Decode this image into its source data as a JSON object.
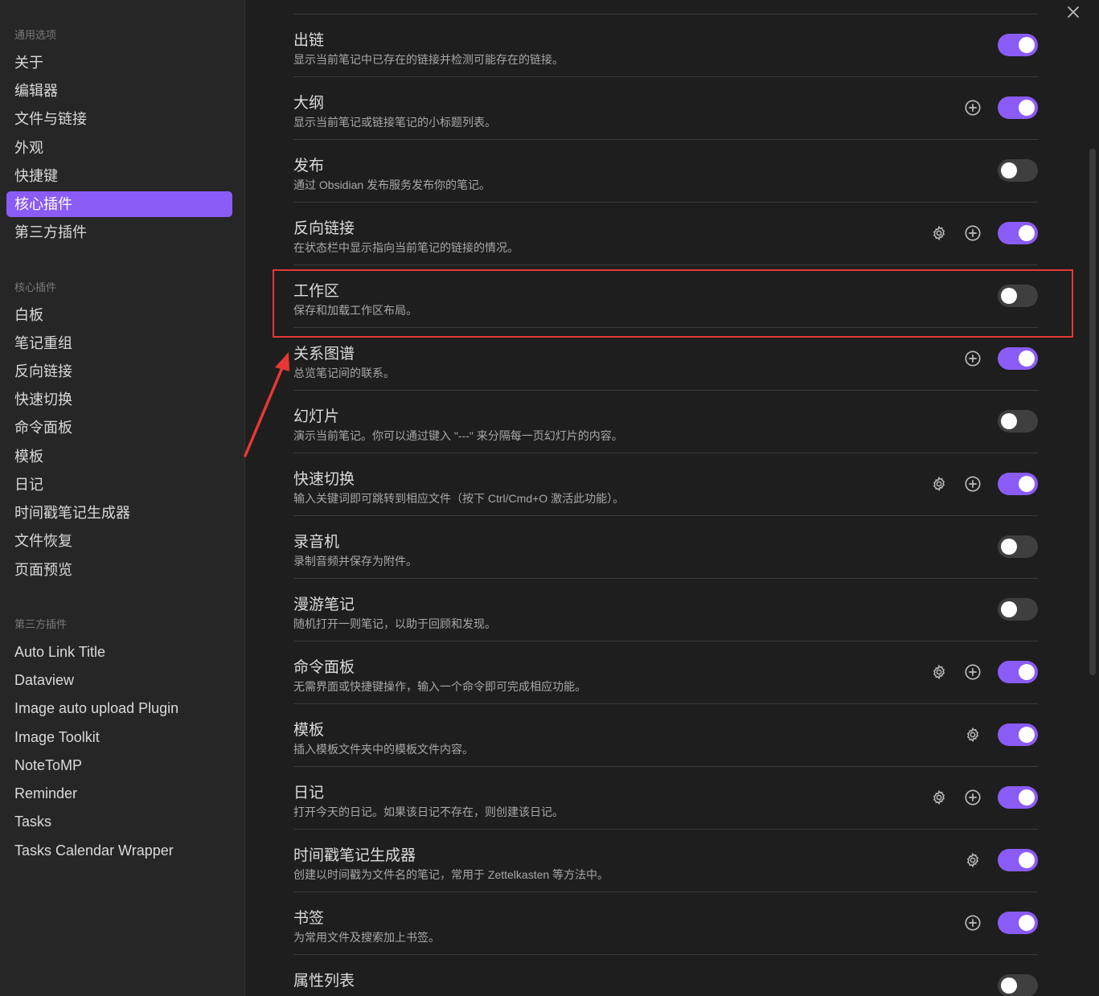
{
  "sidebar": {
    "general_title": "通用选项",
    "general": [
      "关于",
      "编辑器",
      "文件与链接",
      "外观",
      "快捷键",
      "核心插件",
      "第三方插件"
    ],
    "core_title": "核心插件",
    "core": [
      "白板",
      "笔记重组",
      "反向链接",
      "快速切换",
      "命令面板",
      "模板",
      "日记",
      "时间戳笔记生成器",
      "文件恢复",
      "页面预览"
    ],
    "community_title": "第三方插件",
    "community": [
      "Auto Link Title",
      "Dataview",
      "Image auto upload Plugin",
      "Image Toolkit",
      "NoteToMP",
      "Reminder",
      "Tasks",
      "Tasks Calendar Wrapper"
    ],
    "active_item": "核心插件"
  },
  "settings": [
    {
      "title": "出链",
      "desc": "显示当前笔记中已存在的链接并检测可能存在的链接。",
      "gear": false,
      "add": false,
      "enabled": true
    },
    {
      "title": "大纲",
      "desc": "显示当前笔记或链接笔记的小标题列表。",
      "gear": false,
      "add": true,
      "enabled": true
    },
    {
      "title": "发布",
      "desc": "通过 Obsidian 发布服务发布你的笔记。",
      "gear": false,
      "add": false,
      "enabled": false
    },
    {
      "title": "反向链接",
      "desc": "在状态栏中显示指向当前笔记的链接的情况。",
      "gear": true,
      "add": true,
      "enabled": true
    },
    {
      "title": "工作区",
      "desc": "保存和加载工作区布局。",
      "gear": false,
      "add": false,
      "enabled": false
    },
    {
      "title": "关系图谱",
      "desc": "总览笔记间的联系。",
      "gear": false,
      "add": true,
      "enabled": true
    },
    {
      "title": "幻灯片",
      "desc": "演示当前笔记。你可以通过键入 \"---\" 来分隔每一页幻灯片的内容。",
      "gear": false,
      "add": false,
      "enabled": false
    },
    {
      "title": "快速切换",
      "desc": "输入关键词即可跳转到相应文件（按下 Ctrl/Cmd+O 激活此功能）。",
      "gear": true,
      "add": true,
      "enabled": true
    },
    {
      "title": "录音机",
      "desc": "录制音频并保存为附件。",
      "gear": false,
      "add": false,
      "enabled": false
    },
    {
      "title": "漫游笔记",
      "desc": "随机打开一则笔记，以助于回顾和发现。",
      "gear": false,
      "add": false,
      "enabled": false
    },
    {
      "title": "命令面板",
      "desc": "无需界面或快捷键操作，输入一个命令即可完成相应功能。",
      "gear": true,
      "add": true,
      "enabled": true
    },
    {
      "title": "模板",
      "desc": "插入模板文件夹中的模板文件内容。",
      "gear": true,
      "add": false,
      "enabled": true
    },
    {
      "title": "日记",
      "desc": "打开今天的日记。如果该日记不存在，则创建该日记。",
      "gear": true,
      "add": true,
      "enabled": true
    },
    {
      "title": "时间戳笔记生成器",
      "desc": "创建以时间戳为文件名的笔记，常用于 Zettelkasten 等方法中。",
      "gear": true,
      "add": false,
      "enabled": true
    },
    {
      "title": "书签",
      "desc": "为常用文件及搜索加上书签。",
      "gear": false,
      "add": true,
      "enabled": true
    },
    {
      "title": "属性列表",
      "desc": "",
      "gear": false,
      "add": false,
      "enabled": false
    }
  ],
  "colors": {
    "accent": "#8a5cf5",
    "highlight": "#e53935",
    "toggle_off": "#3f3f3f"
  }
}
